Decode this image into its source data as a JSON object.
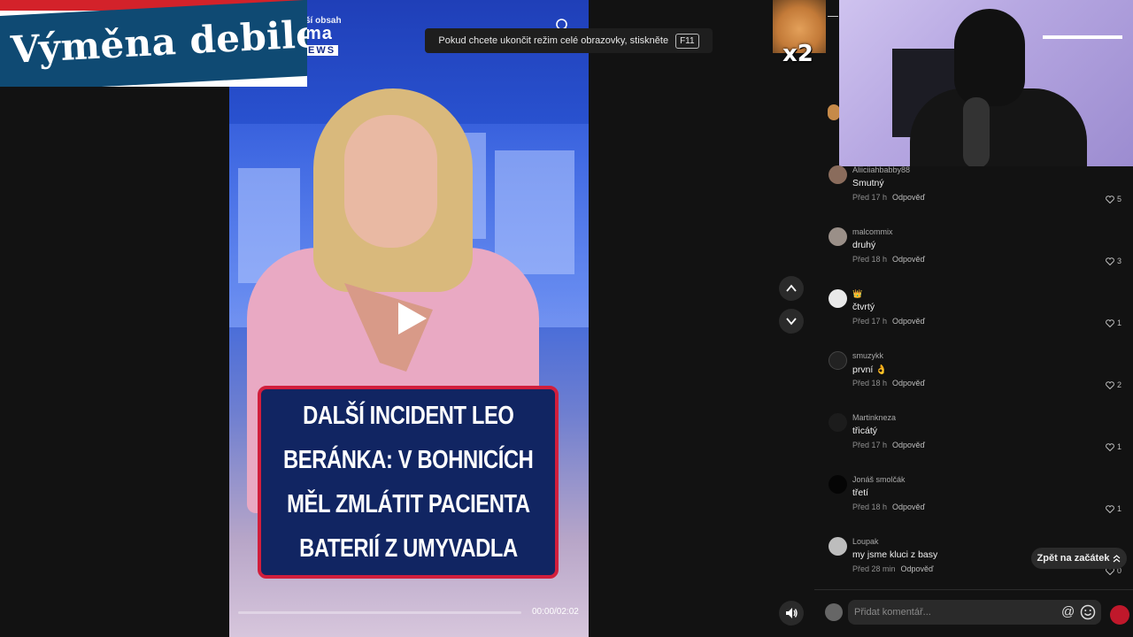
{
  "overlay": {
    "title": "Výměna debilek",
    "fullscreen_hint": "Pokud chcete ukončit režim celé obrazovky, stiskněte",
    "fullscreen_key": "F11",
    "multiplier": "x2"
  },
  "video": {
    "logo_top": "ší obsah",
    "logo_main": "ma",
    "logo_news": "EWS",
    "headline_lines": [
      "DALŠÍ INCIDENT LEO",
      "BERÁNKA: V BOHNICÍCH",
      "MĚL ZMLÁTIT PACIENTA",
      "BATERIÍ Z UMYVADLA"
    ],
    "timecode": "00:00/02:02",
    "progress": 0.0
  },
  "comments": [
    {
      "user": "Aliiciiahbabby88",
      "text": "Smutný",
      "time": "Před 17 h",
      "reply": "Odpověď",
      "likes": "5",
      "avatar_color": "#8a6c5c"
    },
    {
      "user": "malcommix",
      "text": "druhý",
      "time": "Před 18 h",
      "reply": "Odpověď",
      "likes": "3",
      "avatar_color": "#9a8f88"
    },
    {
      "user": "👑",
      "text": "čtvrtý",
      "time": "Před 17 h",
      "reply": "Odpověď",
      "likes": "1",
      "avatar_color": "#e9e9e9"
    },
    {
      "user": "smuzykk",
      "text": "první 👌",
      "time": "Před 18 h",
      "reply": "Odpověď",
      "likes": "2",
      "avatar_color": "#222222"
    },
    {
      "user": "Martinkneza",
      "text": "třicátý",
      "time": "Před 17 h",
      "reply": "Odpověď",
      "likes": "1",
      "avatar_color": "#1c1c1c"
    },
    {
      "user": "Jonáš smolčák",
      "text": "třetí",
      "time": "Před 18 h",
      "reply": "Odpověď",
      "likes": "1",
      "avatar_color": "#050505"
    },
    {
      "user": "Loupak",
      "text": "my jsme kluci z basy",
      "time": "Před 28 min",
      "reply": "Odpověď",
      "likes": "0",
      "avatar_color": "#bdbdbd"
    }
  ],
  "back_to_top": "Zpět na začátek",
  "comment_input": {
    "placeholder": "Přidat komentář..."
  },
  "icons": {
    "nav_up": "chevron-up-icon",
    "nav_down": "chevron-down-icon",
    "volume": "volume-icon",
    "play": "play-icon",
    "mention": "at-icon",
    "emoji": "emoji-icon",
    "heart": "heart-icon"
  }
}
